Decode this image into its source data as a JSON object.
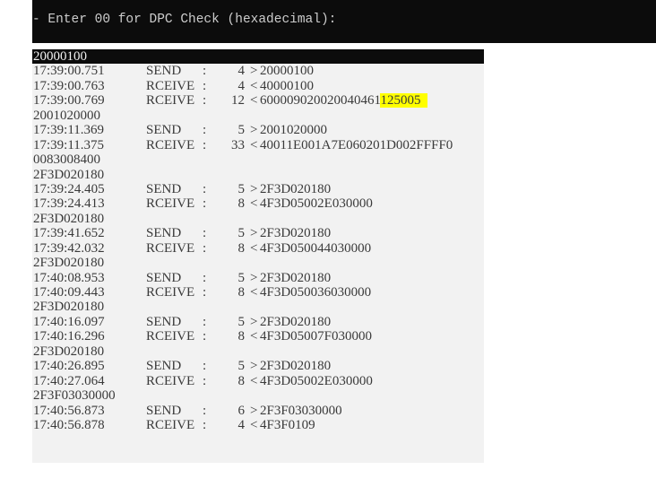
{
  "prompt": "- Enter 00 for DPC Check (hexadecimal):",
  "highlight_color": "#ffff00",
  "rows": [
    {
      "kind": "plain",
      "text": "20000100",
      "selected": true
    },
    {
      "kind": "log",
      "time": "17:39:00.751",
      "dir": "SEND",
      "colon": ":",
      "count": "4",
      "arrow": ">",
      "data": "20000100"
    },
    {
      "kind": "log",
      "time": "17:39:00.763",
      "dir": "RCEIVE",
      "colon": ":",
      "count": "4",
      "arrow": "<",
      "data": "40000100"
    },
    {
      "kind": "log",
      "time": "17:39:00.769",
      "dir": "RCEIVE",
      "colon": ":",
      "count": "12",
      "arrow": "<",
      "data": "600009020020040461",
      "highlight": "125005"
    },
    {
      "kind": "plain",
      "text": "2001020000"
    },
    {
      "kind": "log",
      "time": "17:39:11.369",
      "dir": "SEND",
      "colon": ":",
      "count": "5",
      "arrow": ">",
      "data": "2001020000"
    },
    {
      "kind": "log",
      "time": "17:39:11.375",
      "dir": "RCEIVE",
      "colon": ":",
      "count": "33",
      "arrow": "<",
      "data": "40011E001A7E060201D002FFFF0"
    },
    {
      "kind": "plain",
      "text": "0083008400"
    },
    {
      "kind": "plain",
      "text": "2F3D020180"
    },
    {
      "kind": "log",
      "time": "17:39:24.405",
      "dir": "SEND",
      "colon": ":",
      "count": "5",
      "arrow": ">",
      "data": "2F3D020180"
    },
    {
      "kind": "log",
      "time": "17:39:24.413",
      "dir": "RCEIVE",
      "colon": ":",
      "count": "8",
      "arrow": "<",
      "data": "4F3D05002E030000"
    },
    {
      "kind": "plain",
      "text": "2F3D020180"
    },
    {
      "kind": "log",
      "time": "17:39:41.652",
      "dir": "SEND",
      "colon": ":",
      "count": "5",
      "arrow": ">",
      "data": "2F3D020180"
    },
    {
      "kind": "log",
      "time": "17:39:42.032",
      "dir": "RCEIVE",
      "colon": ":",
      "count": "8",
      "arrow": "<",
      "data": "4F3D050044030000"
    },
    {
      "kind": "plain",
      "text": "2F3D020180"
    },
    {
      "kind": "log",
      "time": "17:40:08.953",
      "dir": "SEND",
      "colon": ":",
      "count": "5",
      "arrow": ">",
      "data": "2F3D020180"
    },
    {
      "kind": "log",
      "time": "17:40:09.443",
      "dir": "RCEIVE",
      "colon": ":",
      "count": "8",
      "arrow": "<",
      "data": "4F3D050036030000"
    },
    {
      "kind": "plain",
      "text": "2F3D020180"
    },
    {
      "kind": "log",
      "time": "17:40:16.097",
      "dir": "SEND",
      "colon": ":",
      "count": "5",
      "arrow": ">",
      "data": "2F3D020180"
    },
    {
      "kind": "log",
      "time": "17:40:16.296",
      "dir": "RCEIVE",
      "colon": ":",
      "count": "8",
      "arrow": "<",
      "data": "4F3D05007F030000"
    },
    {
      "kind": "plain",
      "text": "2F3D020180"
    },
    {
      "kind": "log",
      "time": "17:40:26.895",
      "dir": "SEND",
      "colon": ":",
      "count": "5",
      "arrow": ">",
      "data": "2F3D020180"
    },
    {
      "kind": "log",
      "time": "17:40:27.064",
      "dir": "RCEIVE",
      "colon": ":",
      "count": "8",
      "arrow": "<",
      "data": "4F3D05002E030000"
    },
    {
      "kind": "plain",
      "text": "2F3F03030000"
    },
    {
      "kind": "log",
      "time": "17:40:56.873",
      "dir": "SEND",
      "colon": ":",
      "count": "6",
      "arrow": ">",
      "data": "2F3F03030000"
    },
    {
      "kind": "log",
      "time": "17:40:56.878",
      "dir": "RCEIVE",
      "colon": ":",
      "count": "4",
      "arrow": "<",
      "data": "4F3F0109"
    }
  ]
}
